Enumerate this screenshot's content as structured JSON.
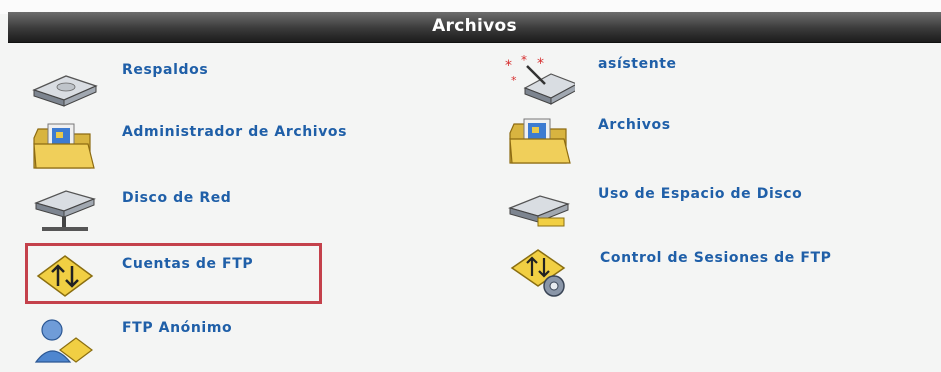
{
  "panel": {
    "title": "Archivos"
  },
  "left_items": [
    {
      "label": "Respaldos",
      "icon": "backup-drive-icon"
    },
    {
      "label": "Administrador de Archivos",
      "icon": "folder-icon"
    },
    {
      "label": "Disco de Red",
      "icon": "network-disk-icon"
    },
    {
      "label": "Cuentas de FTP",
      "icon": "ftp-accounts-icon"
    },
    {
      "label": "FTP Anónimo",
      "icon": "anonymous-ftp-icon"
    }
  ],
  "right_items": [
    {
      "label": "asístente",
      "icon": "wizard-icon"
    },
    {
      "label": "Archivos",
      "icon": "folder-icon"
    },
    {
      "label": "Uso de Espacio de Disco",
      "icon": "disk-usage-icon"
    },
    {
      "label": "Control de Sesiones de FTP",
      "icon": "ftp-sessions-icon"
    }
  ],
  "colors": {
    "link": "#1f5fa8",
    "highlight_border": "#c4414b",
    "header_bg": "#2e2e2e"
  }
}
